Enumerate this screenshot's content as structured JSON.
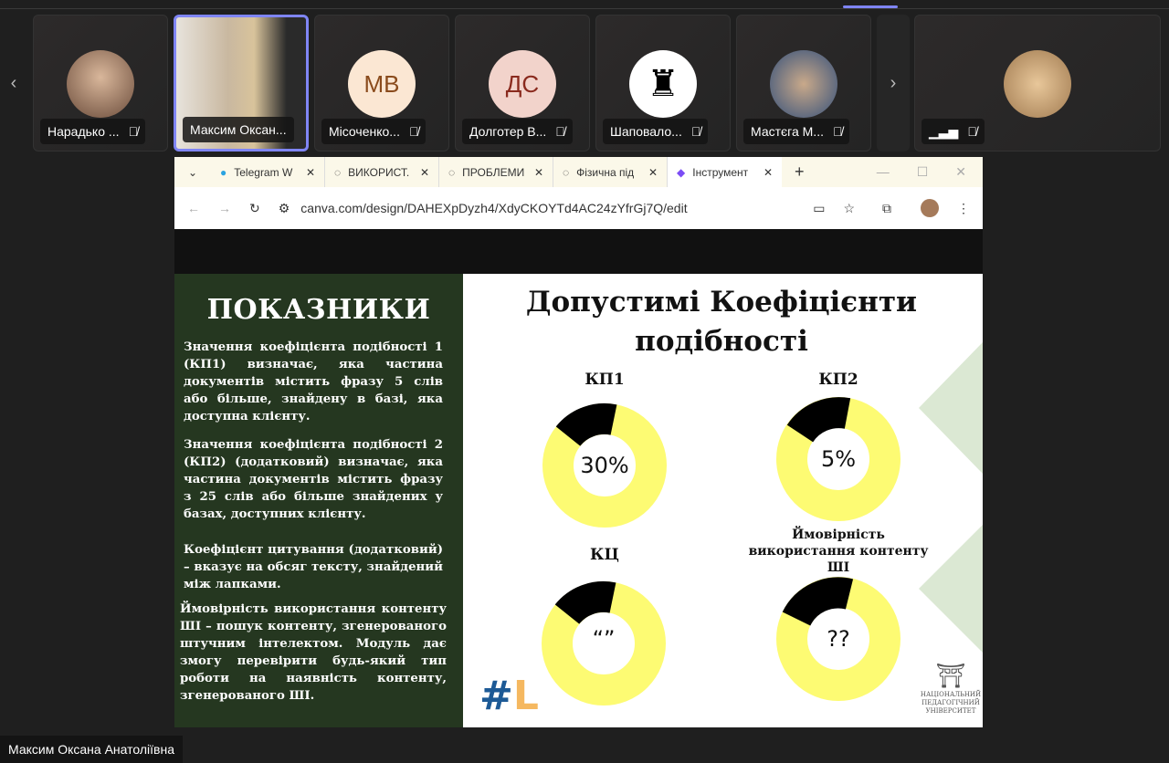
{
  "participants": [
    {
      "name": "Нарадько ...",
      "avatar": "photo",
      "color": "#8a6e5e"
    },
    {
      "name": "Максим Оксан...",
      "avatar": "video",
      "selected": true
    },
    {
      "name": "Місоченко...",
      "initials": "МВ",
      "bg": "#fbe7d3",
      "fg": "#8a4b1c"
    },
    {
      "name": "Долготер В...",
      "initials": "ДС",
      "bg": "#f2d3cb",
      "fg": "#8a2a1e"
    },
    {
      "name": "Шаповало...",
      "avatar": "icon"
    },
    {
      "name": "Мастєга М...",
      "avatar": "photo",
      "color": "#34507a"
    },
    {
      "name": "",
      "avatar": "photo",
      "color": "#c9a67a"
    }
  ],
  "browser": {
    "tabs": [
      "Telegram W",
      "ВИКОРИСТ.",
      "ПРОБЛЕМИ",
      "Фізична під",
      "Інструмент"
    ],
    "new_tab": "+",
    "url": "canva.com/design/DAHEXpDyzh4/XdyCKOYTd4AC24zYfrGj7Q/edit"
  },
  "slide": {
    "left_title": "ПОКАЗНИКИ",
    "paragraphs": [
      "Значення коефіцієнта подібності 1 (КП1) визначає, яка частина документів містить фразу 5 слів або більше, знайдену в базі, яка доступна клієнту.",
      "Значення коефіцієнта подібності 2 (КП2) (додатковий) визначає, яка частина документів містить фразу з 25 слів або більше знайдених у базах, доступних клієнту.",
      "Коефіцієнт цитування (додатковий) – вказує на обсяг тексту, знайдений між лапками.",
      "Ймовірність використання контенту ШІ – пошук контенту, згенерованого штучним інтелектом. Модуль дає змогу перевірити будь-який тип роботи на наявність контенту, згенерованого ШІ."
    ],
    "title_line1": "Допустимі Коефіцієнти",
    "title_line2": "подібності",
    "metrics": [
      {
        "label": "КП1",
        "value": "30%"
      },
      {
        "label": "КП2",
        "value": "5%"
      },
      {
        "label": "КЦ",
        "value": "“”"
      },
      {
        "label": "Ймовірність використання контенту ШІ",
        "value": "??"
      }
    ],
    "logo_left": "#L",
    "logo_right": "НАЦІОНАЛЬНИЙ ПЕДАГОГІЧНИЙ УНІВЕРСИТЕТ"
  },
  "speaker_name": "Максим Оксана Анатоліївна",
  "colors": {
    "accent": "#7f85f5",
    "slide_green": "#253720",
    "donut_yellow": "#fdfb73"
  }
}
